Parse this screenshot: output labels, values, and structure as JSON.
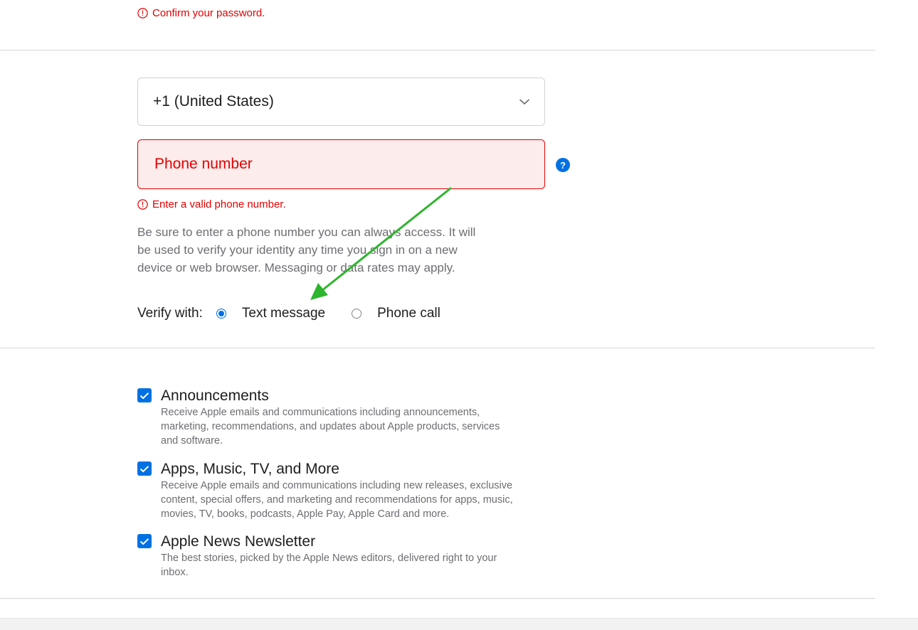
{
  "password_confirm": {
    "error_text": "Confirm your password."
  },
  "country": {
    "selected": "+1 (United States)"
  },
  "phone": {
    "placeholder": "Phone number",
    "help_label": "?",
    "error_text": "Enter a valid phone number."
  },
  "hint": {
    "lines": [
      "Be sure to enter a phone number you can always access. It will",
      "be used to verify your identity any time you sign in on a new",
      "device or web browser. Messaging or data rates may apply."
    ]
  },
  "verify": {
    "label": "Verify with:",
    "options": [
      {
        "label": "Text message",
        "selected": true
      },
      {
        "label": "Phone call",
        "selected": false
      }
    ]
  },
  "subscriptions": [
    {
      "title": "Announcements",
      "checked": true,
      "desc_lines": [
        "Receive Apple emails and communications including announcements,",
        "marketing, recommendations, and updates about Apple products, services",
        "and software."
      ]
    },
    {
      "title": "Apps, Music, TV, and More",
      "checked": true,
      "desc_lines": [
        "Receive Apple emails and communications including new releases, exclusive",
        "content, special offers, and marketing and recommendations for apps, music,",
        "movies, TV, books, podcasts, Apple Pay, Apple Card and more."
      ]
    },
    {
      "title": "Apple News Newsletter",
      "checked": true,
      "desc_lines": [
        "The best stories, picked by the Apple News editors, delivered right to your",
        "inbox."
      ]
    }
  ],
  "colors": {
    "error": "#e30000",
    "accent": "#0071e3",
    "annotation_arrow": "#2db52d"
  },
  "icons": {
    "error": "exclamation-circle-icon",
    "dropdown": "chevron-down-icon",
    "help": "question-icon",
    "checkbox": "checkmark-icon"
  }
}
